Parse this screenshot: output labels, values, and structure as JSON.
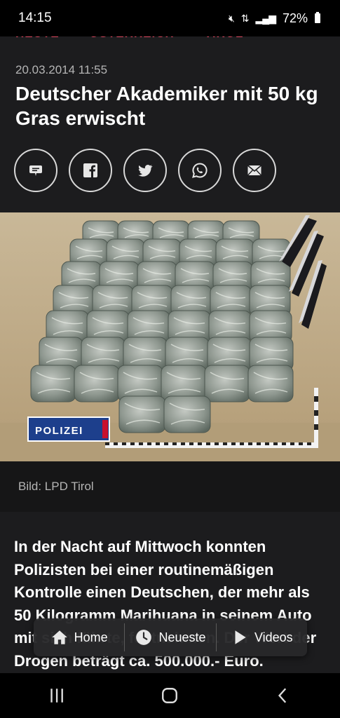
{
  "status_bar": {
    "time": "14:15",
    "battery": "72%"
  },
  "breadcrumb": [
    "HEUTE",
    "ÖSTERREICH",
    "TIROL"
  ],
  "breadcrumb_separator": "›",
  "article": {
    "date": "20.03.2014 11:55",
    "headline": "Deutscher Akademiker mit 50 kg Gras erwischt",
    "image_caption": "Bild: LPD Tirol",
    "image_badge": "POLIZEI",
    "body": "In der Nacht auf Mittwoch konnten Polizisten bei einer routinemäßigen Kontrolle einen Deutschen, der mehr als 50 Kilogramm Marihuana in seinem Auto mit sich führte, festnehmen. Der Wert der Drogen beträgt ca. 500.000.- Euro."
  },
  "share_buttons": [
    "comment-icon",
    "facebook-icon",
    "twitter-icon",
    "whatsapp-icon",
    "mail-icon"
  ],
  "bottom_nav": {
    "home": "Home",
    "latest": "Neueste",
    "videos": "Videos"
  },
  "colors": {
    "background": "#1c1c1e",
    "accent": "#e34b63",
    "caption_bar": "#161617"
  }
}
